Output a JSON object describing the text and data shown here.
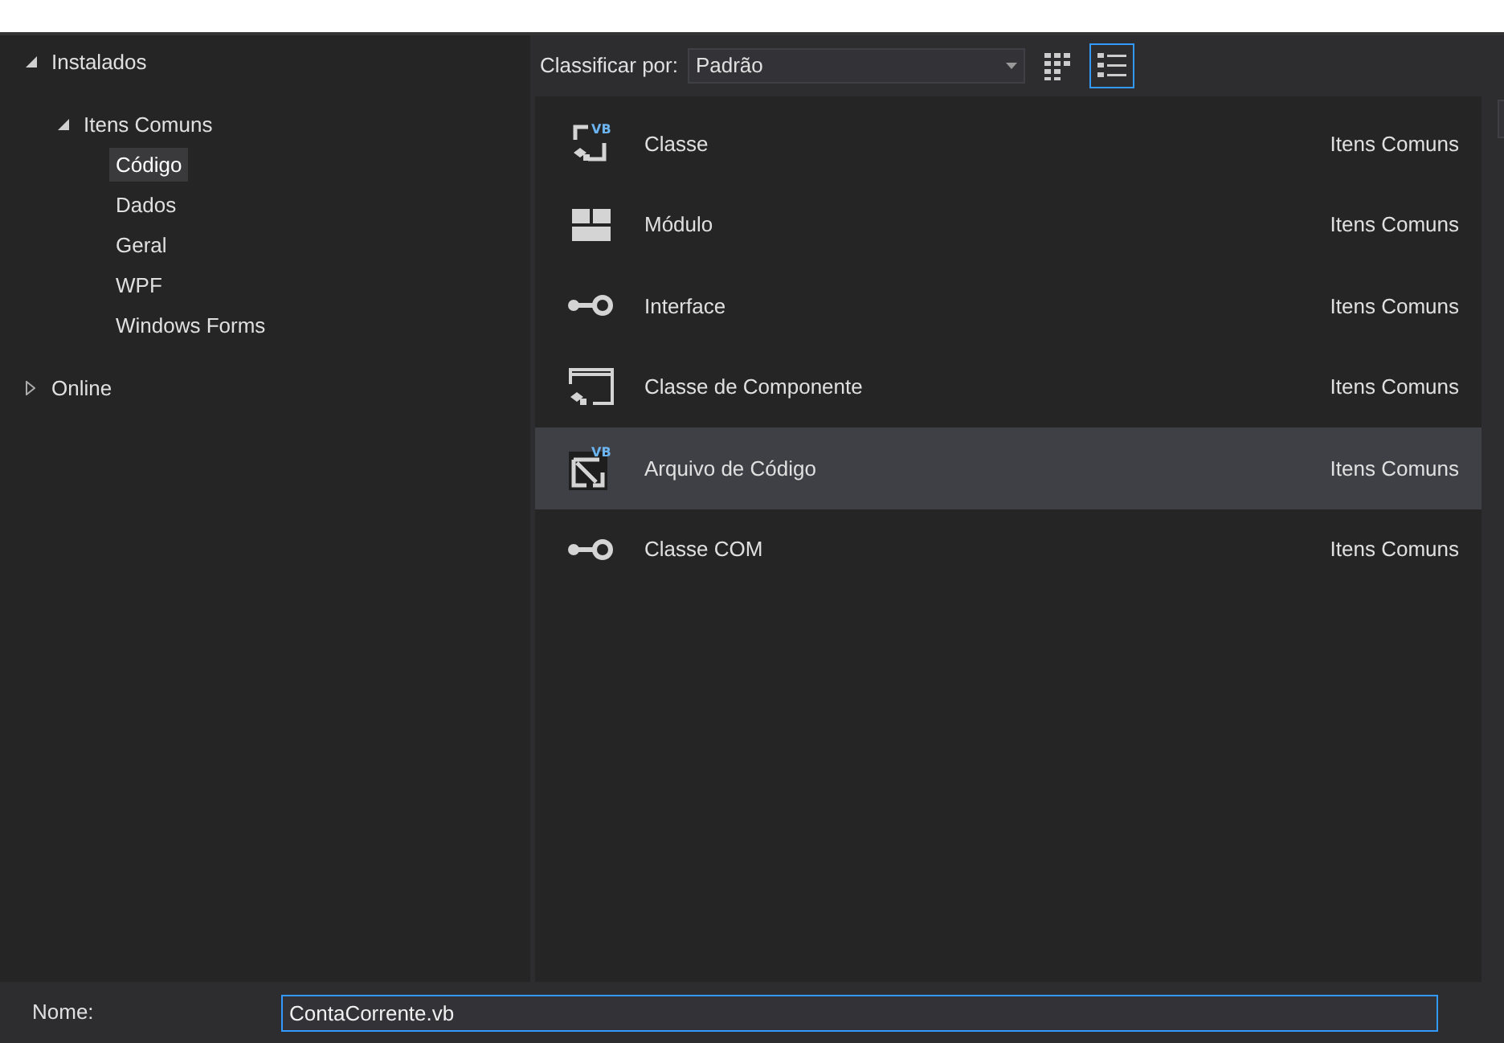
{
  "tree": [
    {
      "label": "Instalados",
      "expanded": true,
      "selected": false,
      "children": [
        {
          "label": "Itens Comuns",
          "expanded": true,
          "selected": false,
          "children": [
            {
              "label": "Código",
              "selected": true
            },
            {
              "label": "Dados",
              "selected": false
            },
            {
              "label": "Geral",
              "selected": false
            },
            {
              "label": "WPF",
              "selected": false
            },
            {
              "label": "Windows Forms",
              "selected": false
            }
          ]
        }
      ]
    },
    {
      "label": "Online",
      "expanded": false,
      "selected": false
    }
  ],
  "sort": {
    "label": "Classificar por:",
    "value": "Padrão"
  },
  "view_modes": [
    {
      "kind": "grid",
      "selected": false
    },
    {
      "kind": "list",
      "selected": true
    }
  ],
  "templates": [
    {
      "kind": "class",
      "badge": "VB",
      "name": "Classe",
      "category": "Itens Comuns",
      "selected": false
    },
    {
      "kind": "module",
      "name": "Módulo",
      "category": "Itens Comuns",
      "selected": false
    },
    {
      "kind": "interface",
      "name": "Interface",
      "category": "Itens Comuns",
      "selected": false
    },
    {
      "kind": "component",
      "name": "Classe de Componente",
      "category": "Itens Comuns",
      "selected": false
    },
    {
      "kind": "codefile",
      "badge": "VB",
      "name": "Arquivo de Código",
      "category": "Itens Comuns",
      "selected": true
    },
    {
      "kind": "interface",
      "name": "Classe COM",
      "category": "Itens Comuns",
      "selected": false
    }
  ],
  "name_field": {
    "label": "Nome:",
    "value": "ContaCorrente.vb"
  }
}
